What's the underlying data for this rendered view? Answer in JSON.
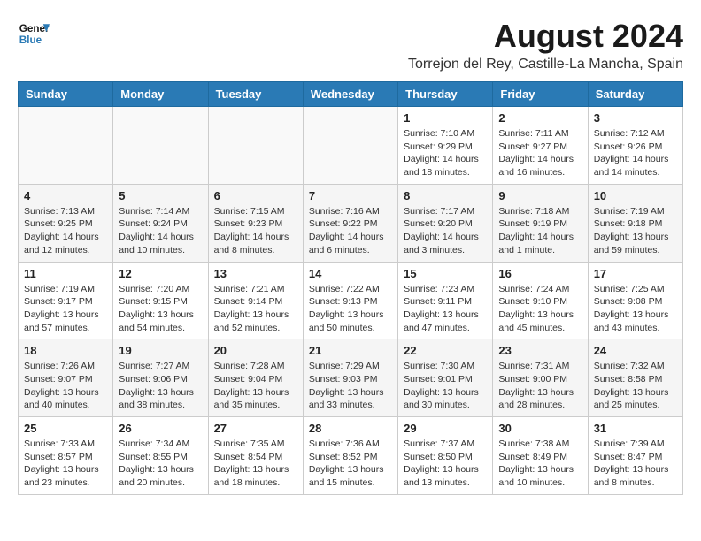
{
  "header": {
    "logo_line1": "General",
    "logo_line2": "Blue",
    "month_title": "August 2024",
    "location": "Torrejon del Rey, Castille-La Mancha, Spain"
  },
  "weekdays": [
    "Sunday",
    "Monday",
    "Tuesday",
    "Wednesday",
    "Thursday",
    "Friday",
    "Saturday"
  ],
  "weeks": [
    [
      {
        "day": "",
        "info": ""
      },
      {
        "day": "",
        "info": ""
      },
      {
        "day": "",
        "info": ""
      },
      {
        "day": "",
        "info": ""
      },
      {
        "day": "1",
        "info": "Sunrise: 7:10 AM\nSunset: 9:29 PM\nDaylight: 14 hours\nand 18 minutes."
      },
      {
        "day": "2",
        "info": "Sunrise: 7:11 AM\nSunset: 9:27 PM\nDaylight: 14 hours\nand 16 minutes."
      },
      {
        "day": "3",
        "info": "Sunrise: 7:12 AM\nSunset: 9:26 PM\nDaylight: 14 hours\nand 14 minutes."
      }
    ],
    [
      {
        "day": "4",
        "info": "Sunrise: 7:13 AM\nSunset: 9:25 PM\nDaylight: 14 hours\nand 12 minutes."
      },
      {
        "day": "5",
        "info": "Sunrise: 7:14 AM\nSunset: 9:24 PM\nDaylight: 14 hours\nand 10 minutes."
      },
      {
        "day": "6",
        "info": "Sunrise: 7:15 AM\nSunset: 9:23 PM\nDaylight: 14 hours\nand 8 minutes."
      },
      {
        "day": "7",
        "info": "Sunrise: 7:16 AM\nSunset: 9:22 PM\nDaylight: 14 hours\nand 6 minutes."
      },
      {
        "day": "8",
        "info": "Sunrise: 7:17 AM\nSunset: 9:20 PM\nDaylight: 14 hours\nand 3 minutes."
      },
      {
        "day": "9",
        "info": "Sunrise: 7:18 AM\nSunset: 9:19 PM\nDaylight: 14 hours\nand 1 minute."
      },
      {
        "day": "10",
        "info": "Sunrise: 7:19 AM\nSunset: 9:18 PM\nDaylight: 13 hours\nand 59 minutes."
      }
    ],
    [
      {
        "day": "11",
        "info": "Sunrise: 7:19 AM\nSunset: 9:17 PM\nDaylight: 13 hours\nand 57 minutes."
      },
      {
        "day": "12",
        "info": "Sunrise: 7:20 AM\nSunset: 9:15 PM\nDaylight: 13 hours\nand 54 minutes."
      },
      {
        "day": "13",
        "info": "Sunrise: 7:21 AM\nSunset: 9:14 PM\nDaylight: 13 hours\nand 52 minutes."
      },
      {
        "day": "14",
        "info": "Sunrise: 7:22 AM\nSunset: 9:13 PM\nDaylight: 13 hours\nand 50 minutes."
      },
      {
        "day": "15",
        "info": "Sunrise: 7:23 AM\nSunset: 9:11 PM\nDaylight: 13 hours\nand 47 minutes."
      },
      {
        "day": "16",
        "info": "Sunrise: 7:24 AM\nSunset: 9:10 PM\nDaylight: 13 hours\nand 45 minutes."
      },
      {
        "day": "17",
        "info": "Sunrise: 7:25 AM\nSunset: 9:08 PM\nDaylight: 13 hours\nand 43 minutes."
      }
    ],
    [
      {
        "day": "18",
        "info": "Sunrise: 7:26 AM\nSunset: 9:07 PM\nDaylight: 13 hours\nand 40 minutes."
      },
      {
        "day": "19",
        "info": "Sunrise: 7:27 AM\nSunset: 9:06 PM\nDaylight: 13 hours\nand 38 minutes."
      },
      {
        "day": "20",
        "info": "Sunrise: 7:28 AM\nSunset: 9:04 PM\nDaylight: 13 hours\nand 35 minutes."
      },
      {
        "day": "21",
        "info": "Sunrise: 7:29 AM\nSunset: 9:03 PM\nDaylight: 13 hours\nand 33 minutes."
      },
      {
        "day": "22",
        "info": "Sunrise: 7:30 AM\nSunset: 9:01 PM\nDaylight: 13 hours\nand 30 minutes."
      },
      {
        "day": "23",
        "info": "Sunrise: 7:31 AM\nSunset: 9:00 PM\nDaylight: 13 hours\nand 28 minutes."
      },
      {
        "day": "24",
        "info": "Sunrise: 7:32 AM\nSunset: 8:58 PM\nDaylight: 13 hours\nand 25 minutes."
      }
    ],
    [
      {
        "day": "25",
        "info": "Sunrise: 7:33 AM\nSunset: 8:57 PM\nDaylight: 13 hours\nand 23 minutes."
      },
      {
        "day": "26",
        "info": "Sunrise: 7:34 AM\nSunset: 8:55 PM\nDaylight: 13 hours\nand 20 minutes."
      },
      {
        "day": "27",
        "info": "Sunrise: 7:35 AM\nSunset: 8:54 PM\nDaylight: 13 hours\nand 18 minutes."
      },
      {
        "day": "28",
        "info": "Sunrise: 7:36 AM\nSunset: 8:52 PM\nDaylight: 13 hours\nand 15 minutes."
      },
      {
        "day": "29",
        "info": "Sunrise: 7:37 AM\nSunset: 8:50 PM\nDaylight: 13 hours\nand 13 minutes."
      },
      {
        "day": "30",
        "info": "Sunrise: 7:38 AM\nSunset: 8:49 PM\nDaylight: 13 hours\nand 10 minutes."
      },
      {
        "day": "31",
        "info": "Sunrise: 7:39 AM\nSunset: 8:47 PM\nDaylight: 13 hours\nand 8 minutes."
      }
    ]
  ]
}
